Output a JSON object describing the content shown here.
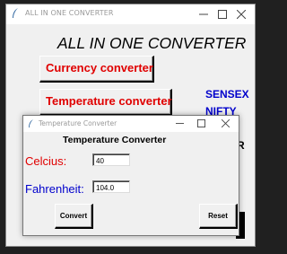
{
  "main_window": {
    "title": "ALL IN ONE CONVERTER",
    "heading": "ALL IN ONE CONVERTER",
    "buttons": {
      "currency": "Currency converter",
      "temperature": "Temperature converter"
    },
    "side_labels": {
      "sensex": "SENSEX",
      "nifty": "NIFTY",
      "partial": "R"
    },
    "icons": {
      "app": "feather-icon",
      "minimize": "minimize-icon",
      "maximize": "maximize-icon",
      "close": "close-icon"
    }
  },
  "dialog": {
    "title": "Temperature Converter",
    "heading": "Temperature Converter",
    "celcius": {
      "label": "Celcius:",
      "value": "40",
      "color": "#e00000"
    },
    "fahrenheit": {
      "label": "Fahrenheit:",
      "value": "104.0",
      "color": "#0000cc"
    },
    "buttons": {
      "convert": "Convert",
      "reset": "Reset"
    }
  },
  "colors": {
    "button_text": "#e00000",
    "side_text": "#0000cc",
    "window_bg": "#f0f0f0",
    "titlebar_text": "#999999"
  }
}
